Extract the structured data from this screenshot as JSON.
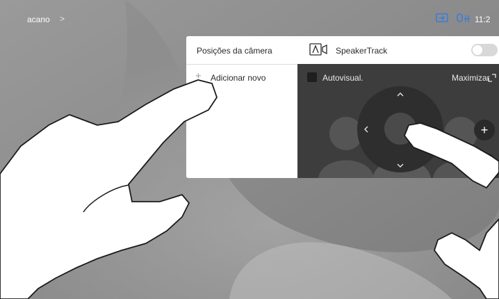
{
  "topbar": {
    "site_name": "acano",
    "chevron": ">",
    "clock": "11:2"
  },
  "camera_panel": {
    "positions_title": "Posições da câmera",
    "add_plus": "+",
    "add_new_label": "Adicionar novo",
    "speakertrack_label": "SpeakerTrack",
    "speakertrack_on": false,
    "selfview_label": "Autovisual.",
    "maximize_label": "Maximizar",
    "zoom_in": "+"
  },
  "icons": {
    "share": "share-screen-icon",
    "mic": "mic-icon",
    "camera": "camera-icon",
    "maximize": "maximize-icon"
  },
  "colors": {
    "background": "#8e8e8e",
    "panel": "#ffffff",
    "video": "#3d3d3d",
    "accent": "#3b7dd8"
  }
}
